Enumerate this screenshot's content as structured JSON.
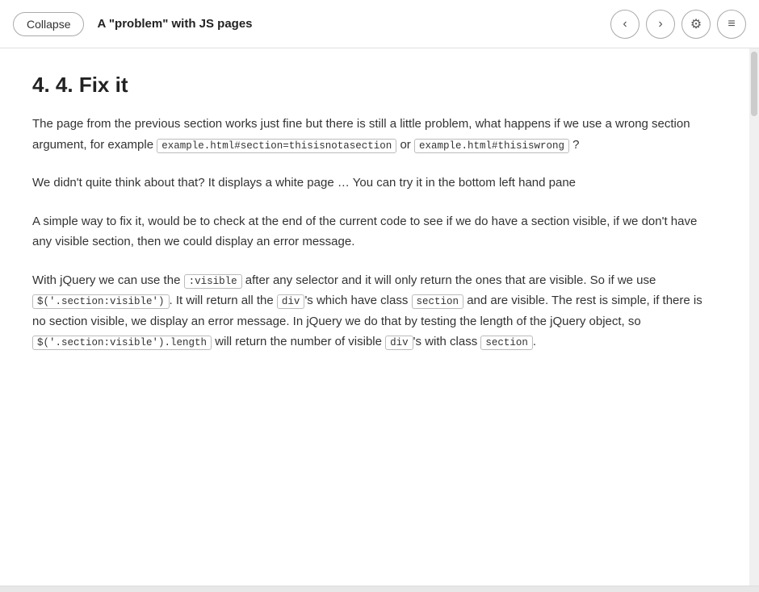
{
  "header": {
    "collapse_label": "Collapse",
    "title": "A \"problem\" with JS pages",
    "nav_back": "‹",
    "nav_forward": "›",
    "settings_icon": "⚙",
    "menu_icon": "≡"
  },
  "content": {
    "section_title": "4. 4. Fix it",
    "paragraphs": [
      {
        "id": "p1",
        "parts": [
          {
            "type": "text",
            "value": "The page from the previous section works just fine but there is still a little problem, what happens if we use a wrong section argument, for example "
          },
          {
            "type": "code",
            "value": "example.html#section=thisisnotasection"
          },
          {
            "type": "text",
            "value": " or "
          },
          {
            "type": "code",
            "value": "example.html#thisiswrong"
          },
          {
            "type": "text",
            "value": " ?"
          }
        ]
      },
      {
        "id": "p2",
        "parts": [
          {
            "type": "text",
            "value": "We didn't quite think about that? It displays a white page … You can try it in the bottom left hand pane"
          }
        ]
      },
      {
        "id": "p3",
        "parts": [
          {
            "type": "text",
            "value": "A simple way to fix it, would be to check at the end of the current code to see if we do have a section visible, if we don't have any visible section, then we could display an error message."
          }
        ]
      },
      {
        "id": "p4",
        "parts": [
          {
            "type": "text",
            "value": "With jQuery we can use the "
          },
          {
            "type": "code",
            "value": ":visible"
          },
          {
            "type": "text",
            "value": " after any selector and it will only return the ones that are visible. So if we use "
          },
          {
            "type": "code",
            "value": "$('.section:visible')"
          },
          {
            "type": "text",
            "value": ". It will return all the "
          },
          {
            "type": "code",
            "value": "div"
          },
          {
            "type": "text",
            "value": "'s which have class "
          },
          {
            "type": "code",
            "value": "section"
          },
          {
            "type": "text",
            "value": " and are visible. The rest is simple, if there is no section visible, we display an error message. In jQuery we do that by testing the length of the jQuery object, so "
          },
          {
            "type": "code",
            "value": "$('.section:visible').length"
          },
          {
            "type": "text",
            "value": " will return the number of visible "
          },
          {
            "type": "code",
            "value": "div"
          },
          {
            "type": "text",
            "value": "'s with class "
          },
          {
            "type": "code",
            "value": "section"
          },
          {
            "type": "text",
            "value": "."
          }
        ]
      }
    ]
  }
}
